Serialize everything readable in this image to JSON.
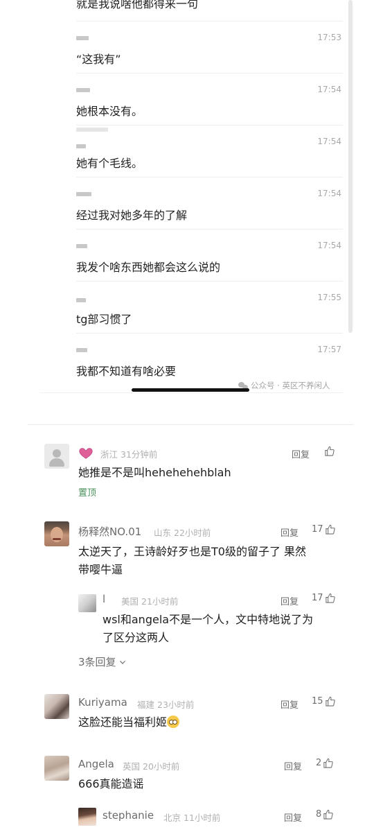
{
  "chat": {
    "top_line": "就是我说啥他都得来一句",
    "messages": [
      {
        "time": "17:53",
        "text": "“这我有”"
      },
      {
        "time": "17:54",
        "text": "她根本没有。"
      },
      {
        "time": "17:54",
        "text": "她有个毛线。"
      },
      {
        "time": "17:54",
        "text": "经过我对她多年的了解"
      },
      {
        "time": "17:54",
        "text": "我发个啥东西她都会这么说的"
      },
      {
        "time": "17:55",
        "text": "tg部习惯了"
      },
      {
        "time": "17:57",
        "text": "我都不知道有啥必要"
      }
    ],
    "watermark": "公众号 · 英区不养闲人"
  },
  "comments": [
    {
      "name": "",
      "location": "浙江",
      "time": "31分钟前",
      "reply_label": "回复",
      "likes": "",
      "text": "她推是不是叫hehehehehblah",
      "pinned": "置顶"
    },
    {
      "name": "杨释然NO.01",
      "location": "山东",
      "time": "22小时前",
      "reply_label": "回复",
      "likes": "17",
      "text_lines": [
        "太逆天了，王诗龄好歹也是T0级的留子了 果然",
        "带嘤牛逼"
      ],
      "reply": {
        "name": "l",
        "location": "美国",
        "time": "21小时前",
        "reply_label": "回复",
        "likes": "17",
        "text_lines": [
          "wsl和angela不是一个人，文中特地说了为",
          "了区分这两人"
        ]
      },
      "more_replies": "3条回复"
    },
    {
      "name": "Kuriyama",
      "location": "福建",
      "time": "23小时前",
      "reply_label": "回复",
      "likes": "15",
      "text": "这脸还能当福利姬"
    },
    {
      "name": "Angela",
      "location": "英国",
      "time": "20小时前",
      "reply_label": "回复",
      "likes": "2",
      "text": "666真能造谣"
    },
    {
      "name": "stephanie",
      "location": "北京",
      "time": "11小时前",
      "reply_label": "回复",
      "likes": "8"
    }
  ],
  "colors": {
    "pinned": "#4a8f5c",
    "meta": "#b0b0b0",
    "heart": "#e0609a"
  }
}
